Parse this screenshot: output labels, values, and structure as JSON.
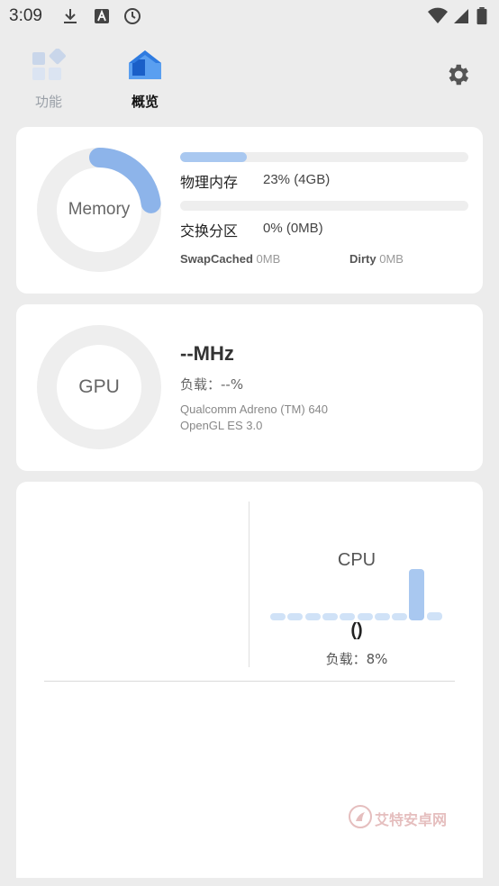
{
  "status_bar": {
    "time": "3:09"
  },
  "tabs": [
    {
      "label": "功能",
      "icon": "grid-icon"
    },
    {
      "label": "概览",
      "icon": "home-icon"
    }
  ],
  "memory": {
    "ring_label": "Memory",
    "ring_fraction": 0.23,
    "physical": {
      "label": "物理内存",
      "value": "23% (4GB)",
      "fraction": 0.23
    },
    "swap": {
      "label": "交换分区",
      "value": "0% (0MB)",
      "fraction": 0.0
    },
    "swap_cached": {
      "label": "SwapCached",
      "value": "0MB"
    },
    "dirty": {
      "label": "Dirty",
      "value": "0MB"
    }
  },
  "gpu": {
    "ring_label": "GPU",
    "freq": "--MHz",
    "load": "负载：--%",
    "renderer": "Qualcomm Adreno (TM) 640",
    "api": "OpenGL ES 3.0"
  },
  "cpu": {
    "title": "CPU",
    "freq": "()",
    "load": "负载：8%",
    "bar_levels": [
      0.1,
      0.1,
      0.1,
      0.1,
      0.1,
      0.1,
      0.1,
      0.1,
      0.95,
      0.15
    ]
  },
  "watermark": {
    "text": "艾特安卓网"
  },
  "colors": {
    "accent": "#8db4ea",
    "accent_light": "#a9c8f0",
    "ring_track": "#eeeeee"
  }
}
